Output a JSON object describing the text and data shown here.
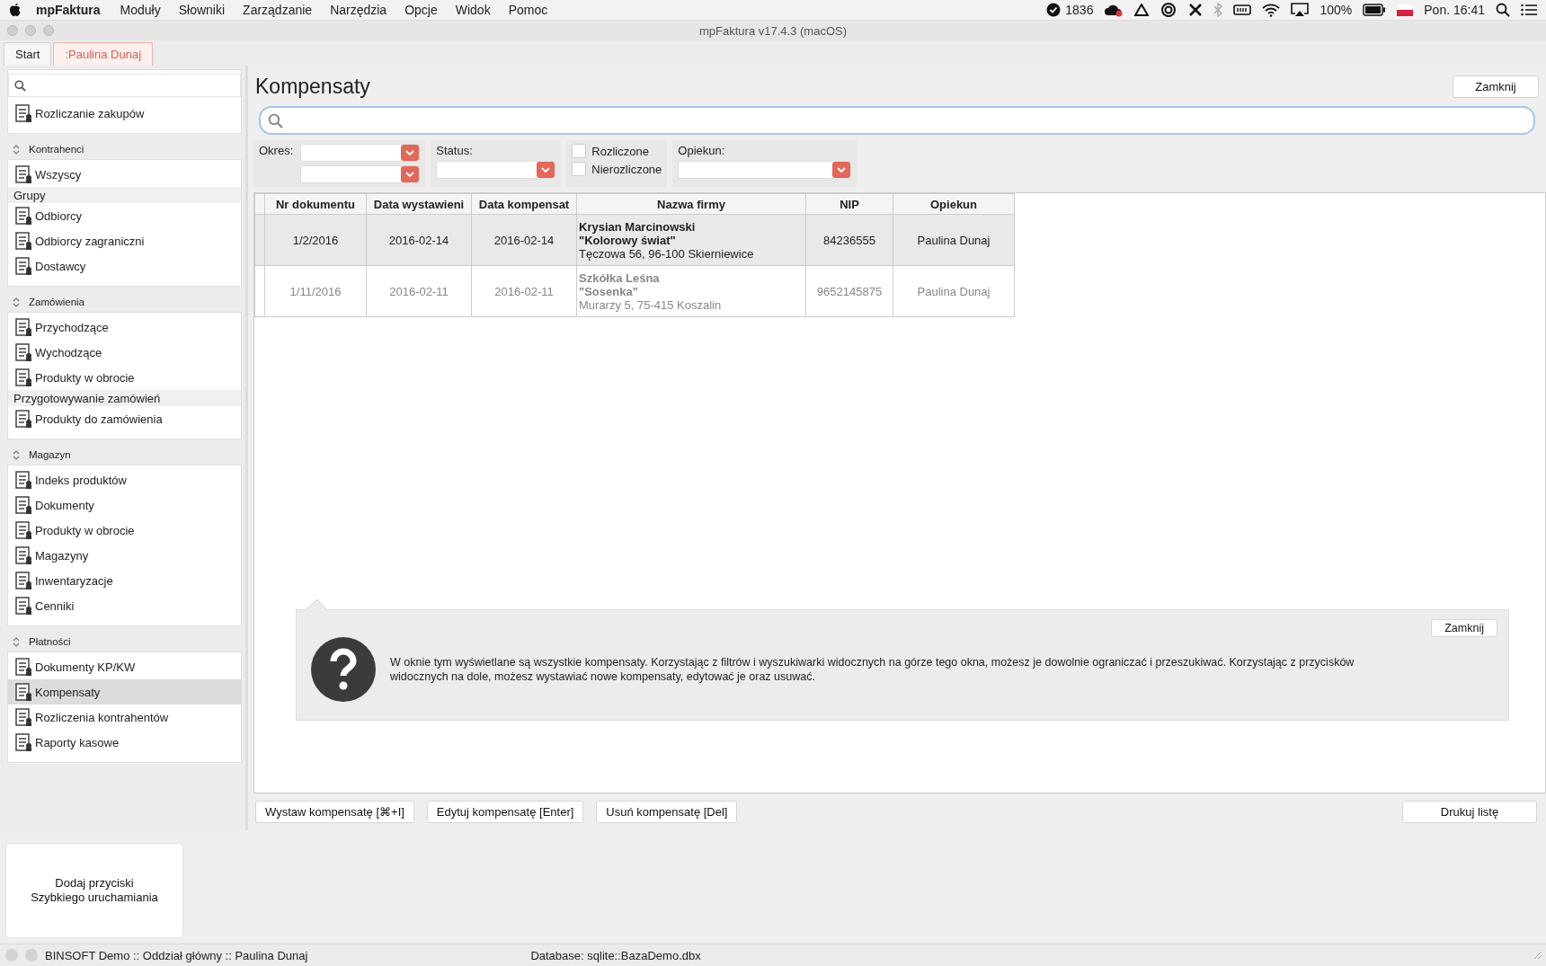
{
  "menu_bar": {
    "app_name": "mpFaktura",
    "menus": [
      "Moduły",
      "Słowniki",
      "Zarządzanie",
      "Narzędzia",
      "Opcje",
      "Widok",
      "Pomoc"
    ],
    "counter": "1836",
    "battery": "100%",
    "clock": "Pon. 16:41"
  },
  "window": {
    "title": "mpFaktura v17.4.3 (macOS)"
  },
  "tabs": [
    {
      "label": "Start",
      "selected": false
    },
    {
      "label": ":Paulina Dunaj",
      "selected": true
    }
  ],
  "sidebar": {
    "top_items": [
      {
        "label": "Rozliczanie zakupów",
        "kind": "item",
        "selected": false
      }
    ],
    "sections": [
      {
        "title": "Kontrahenci",
        "items": [
          {
            "label": "Wszyscy",
            "kind": "item",
            "selected": false
          },
          {
            "label": "Grupy",
            "kind": "group"
          },
          {
            "label": "Odbiorcy",
            "kind": "item",
            "selected": false
          },
          {
            "label": "Odbiorcy zagraniczni",
            "kind": "item",
            "selected": false
          },
          {
            "label": "Dostawcy",
            "kind": "item",
            "selected": false
          }
        ]
      },
      {
        "title": "Zamówienia",
        "items": [
          {
            "label": "Przychodzące",
            "kind": "item",
            "selected": false
          },
          {
            "label": "Wychodzące",
            "kind": "item",
            "selected": false
          },
          {
            "label": "Produkty w obrocie",
            "kind": "item",
            "selected": false
          },
          {
            "label": "Przygotowywanie zamówień",
            "kind": "group"
          },
          {
            "label": "Produkty do zamówienia",
            "kind": "item",
            "selected": false
          }
        ]
      },
      {
        "title": "Magazyn",
        "items": [
          {
            "label": "Indeks produktów",
            "kind": "item",
            "selected": false
          },
          {
            "label": "Dokumenty",
            "kind": "item",
            "selected": false
          },
          {
            "label": "Produkty w obrocie",
            "kind": "item",
            "selected": false
          },
          {
            "label": "Magazyny",
            "kind": "item",
            "selected": false
          },
          {
            "label": "Inwentaryzacje",
            "kind": "item",
            "selected": false
          },
          {
            "label": "Cenniki",
            "kind": "item",
            "selected": false
          }
        ]
      },
      {
        "title": "Płatności",
        "items": [
          {
            "label": "Dokumenty KP/KW",
            "kind": "item",
            "selected": false
          },
          {
            "label": "Kompensaty",
            "kind": "item",
            "selected": true
          },
          {
            "label": "Rozliczenia kontrahentów",
            "kind": "item",
            "selected": false
          },
          {
            "label": "Raporty kasowe",
            "kind": "item",
            "selected": false
          }
        ]
      }
    ]
  },
  "quick_launch": {
    "label": "Dodaj przyciski\nSzybkiego uruchamiania"
  },
  "page": {
    "title": "Kompensaty",
    "close_button": "Zamknij",
    "filters": [
      {
        "kind": "period",
        "label": "Okres:"
      },
      {
        "kind": "select",
        "label": "Status:"
      },
      {
        "kind": "checks",
        "checkboxes": [
          {
            "label": "Rozliczone",
            "checked": false
          },
          {
            "label": "Nierozliczone",
            "checked": false
          }
        ]
      },
      {
        "kind": "select",
        "label": "Opiekun:"
      }
    ],
    "table": {
      "columns": [
        "Nr dokumentu",
        "Data wystawieni",
        "Data kompensat",
        "Nazwa firmy",
        "NIP",
        "Opiekun"
      ],
      "rows": [
        {
          "selected": true,
          "greyed": false,
          "number": "1/2/2016",
          "issue_date": "2016-02-14",
          "offset_date": "2016-02-14",
          "company_name": "Krysian Marcinowski",
          "company_name_2": "\"Kolorowy świat\"",
          "address": "Tęczowa 56, 96-100 Skierniewice",
          "nip": "84236555",
          "caretaker": "Paulina Dunaj"
        },
        {
          "selected": false,
          "greyed": true,
          "number": "1/11/2016",
          "issue_date": "2016-02-11",
          "offset_date": "2016-02-11",
          "company_name": "Szkółka Leśna",
          "company_name_2": "\"Sosenka\"",
          "address": "Murarzy 5, 75-415 Koszalin",
          "nip": "9652145875",
          "caretaker": "Paulina Dunaj"
        }
      ]
    },
    "help": {
      "text": "W oknie tym wyświetlane są wszystkie kompensaty. Korzystając z filtrów i wyszukiwarki widocznych na górze tego okna, możesz je dowolnie ograniczać i przeszukiwać. Korzystając z przycisków widocznych na dole, możesz wystawiać nowe kompensaty, edytować je oraz usuwać.",
      "close_button": "Zamknij"
    },
    "buttons": [
      "Wystaw kompensatę [⌘+I]",
      "Edytuj kompensatę [Enter]",
      "Usuń kompensatę [Del]"
    ],
    "print_button": "Drukuj listę"
  },
  "status_bar": {
    "user_info": "BINSOFT Demo :: Oddział główny :: Paulina Dunaj",
    "database": "Database: sqlite::BazaDemo.dbx"
  }
}
